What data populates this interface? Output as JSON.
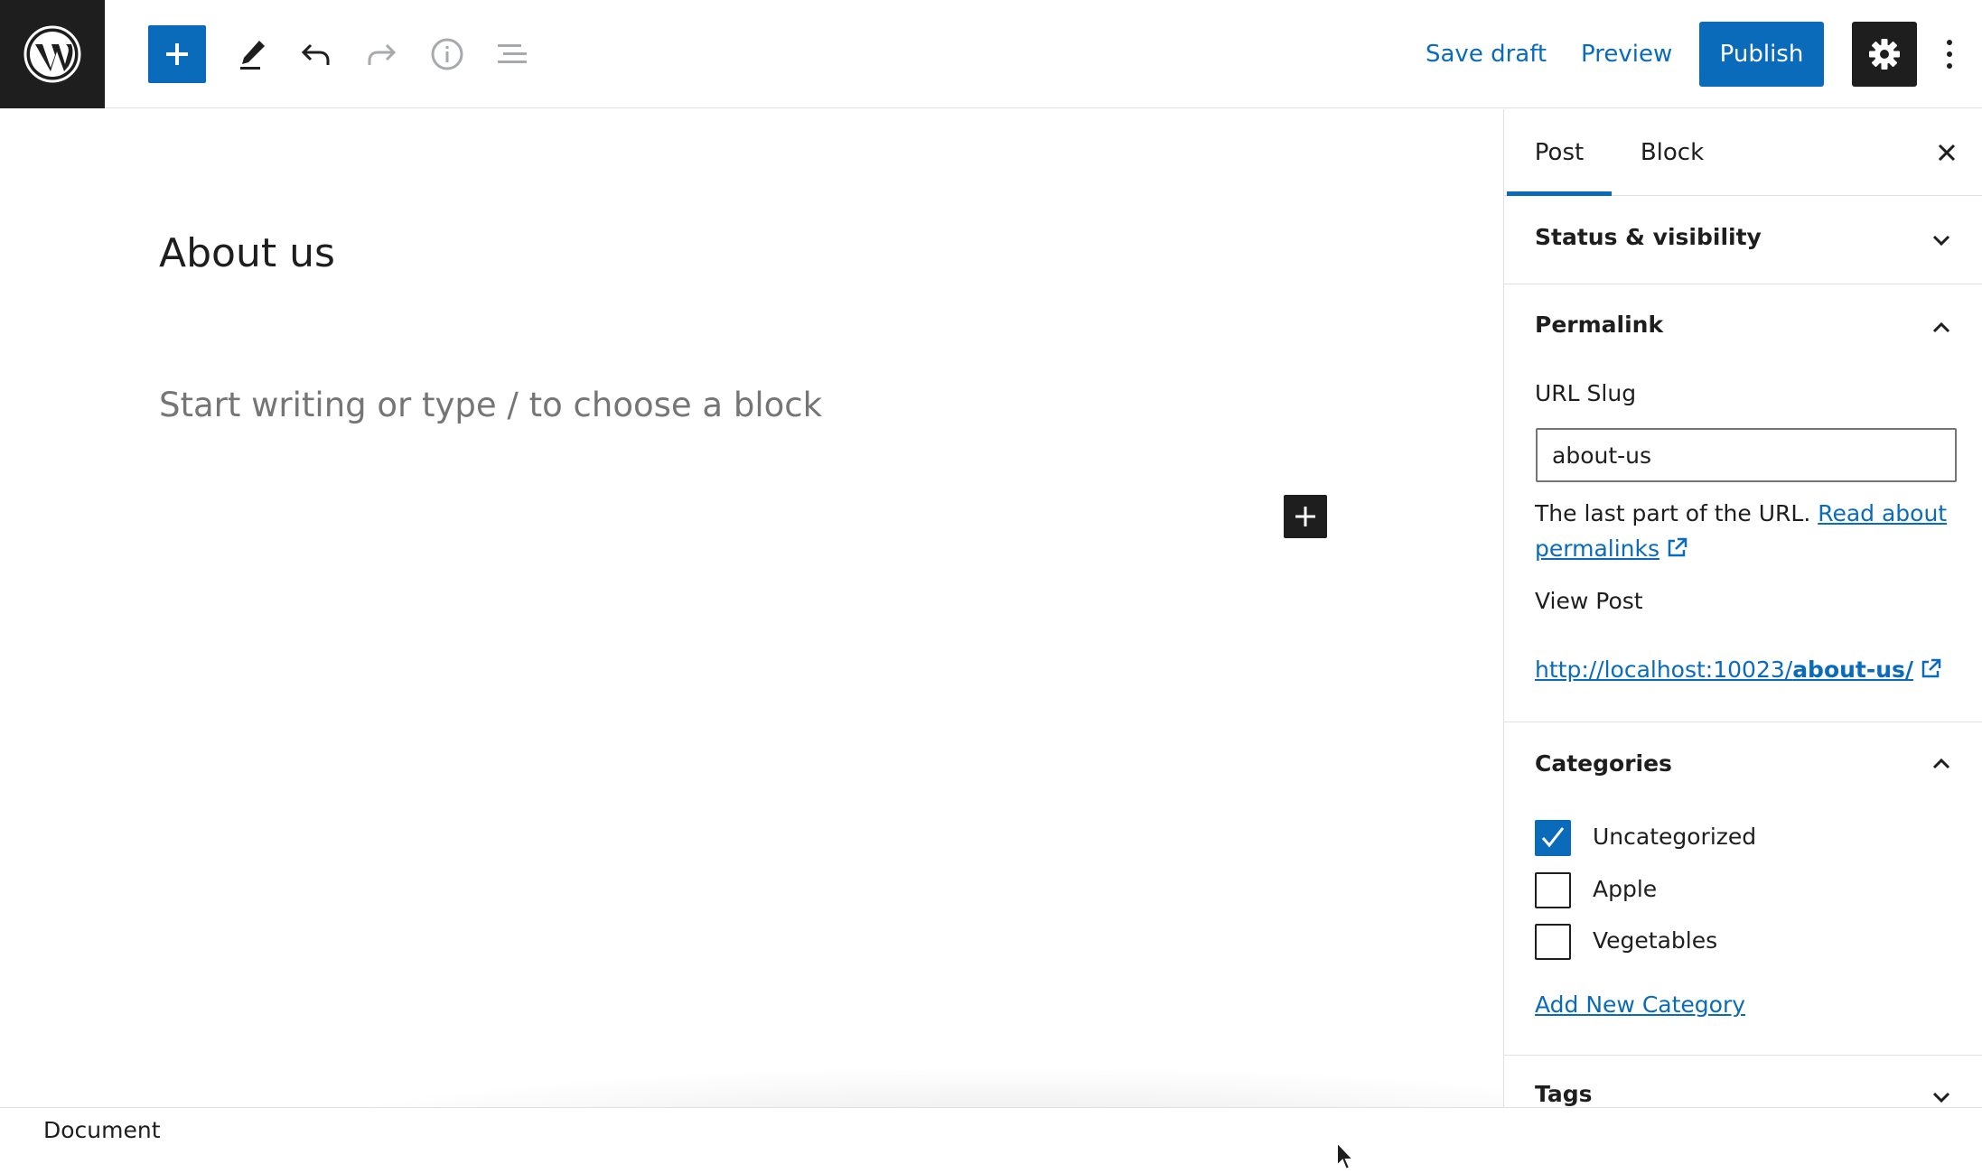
{
  "toolbar": {
    "save_draft": "Save draft",
    "preview": "Preview",
    "publish": "Publish",
    "icons": [
      "wordpress-logo",
      "plus-icon",
      "pencil-icon",
      "undo-icon",
      "redo-icon",
      "info-icon",
      "list-view-icon",
      "gear-icon",
      "more-vertical-icon"
    ]
  },
  "editor": {
    "title": "About us",
    "placeholder": "Start writing or type / to choose a block"
  },
  "footer": {
    "breadcrumb": "Document"
  },
  "sidebar": {
    "tabs": [
      {
        "label": "Post",
        "active": true
      },
      {
        "label": "Block",
        "active": false
      }
    ],
    "status_visibility": {
      "title": "Status & visibility",
      "expanded": false
    },
    "permalink": {
      "title": "Permalink",
      "expanded": true,
      "slug_label": "URL Slug",
      "slug_value": "about-us",
      "help_prefix": "The last part of the URL.",
      "help_link": "Read about permalinks",
      "view_post_label": "View Post",
      "url_prefix": "http://localhost:10023/",
      "url_slug": "about-us/"
    },
    "categories": {
      "title": "Categories",
      "expanded": true,
      "items": [
        {
          "label": "Uncategorized",
          "checked": true
        },
        {
          "label": "Apple",
          "checked": false
        },
        {
          "label": "Vegetables",
          "checked": false
        }
      ],
      "add_new": "Add New Category"
    },
    "tags": {
      "title": "Tags",
      "expanded": false
    }
  },
  "colors": {
    "accent": "#0a6bbb",
    "dark": "#1e1e1e",
    "border": "#e0e0e0",
    "muted": "#757575"
  }
}
